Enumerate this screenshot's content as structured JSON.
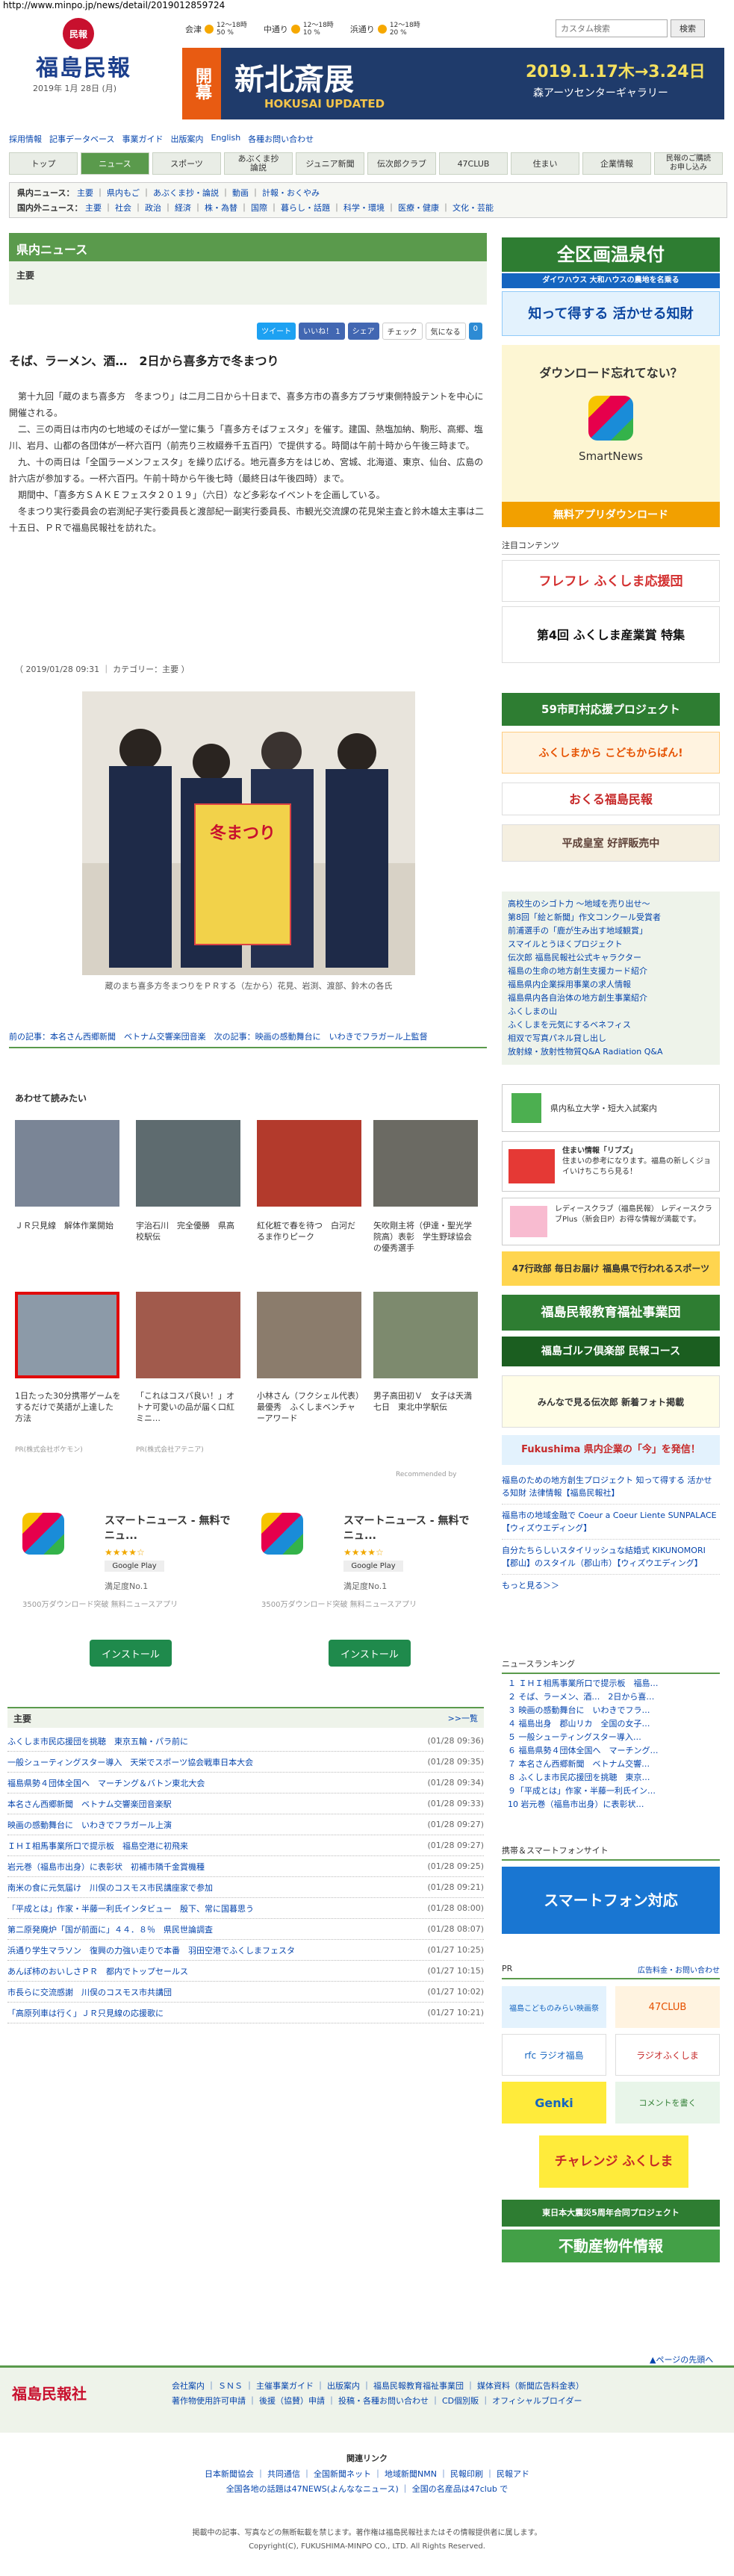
{
  "url": "http://www.minpo.jp/news/detail/2019012859724",
  "brand": {
    "logo_seal": "民報",
    "name": "福島民報",
    "date": "2019年 1月 28日 (月)",
    "green": "#5a9a4c"
  },
  "weather": [
    {
      "city": "会津",
      "temp": "12〜18時",
      "pct": "50 %"
    },
    {
      "city": "中通り",
      "temp": "12〜18時",
      "pct": "10 %"
    },
    {
      "city": "浜通り",
      "temp": "12〜18時",
      "pct": "20 %"
    }
  ],
  "search": {
    "placeholder": "カスタム検索",
    "button": "検索"
  },
  "ad_top": {
    "kanji": "開幕",
    "headline": "新北斎展",
    "sub": "HOKUSAI UPDATED",
    "dates": "2019.1.17木→3.24日",
    "venue": "森アーツセンターギャラリー"
  },
  "util_links": [
    "採用情報",
    "記事データベース",
    "事業ガイド",
    "出版案内",
    "English",
    "各種お問い合わせ"
  ],
  "tabs": [
    "トップ",
    "ニュース",
    "スポーツ",
    "あぶくま抄\n論説",
    "ジュニア新聞",
    "伝次郎クラブ",
    "47CLUB",
    "住まい",
    "企業情報",
    "民報のご購読\nお申し込み"
  ],
  "subnav1": {
    "label": "県内ニュース：",
    "items": [
      "主要",
      "県内もご",
      "あぶくま抄・論説",
      "動画",
      "計報・おくやみ"
    ]
  },
  "subnav2": {
    "label": "国内外ニュース：",
    "items": [
      "主要",
      "社会",
      "政治",
      "経済",
      "株・為替",
      "国際",
      "暮らし・話題",
      "科学・環境",
      "医療・健康",
      "文化・芸能"
    ]
  },
  "section_title": "県内ニュース",
  "section_sub": "主要",
  "share": {
    "tweet": "ツイート",
    "like": "いいね！ 1",
    "share": "シェア",
    "check": "チェック",
    "pocket": "気になる",
    "count": "0"
  },
  "article": {
    "title": "そば、ラーメン、酒…　2日から喜多方で冬まつり",
    "p1": "第十九回「蔵のまち喜多方　冬まつり」は二月二日から十日まで、喜多方市の喜多方プラザ東側特設テントを中心に開催される。",
    "p2": "二、三の両日は市内の七地域のそばが一堂に集う「喜多方そばフェスタ」を催す。建国、熱塩加納、駒形、高郷、塩川、岩月、山都の各団体が一杯六百円（前売り三枚綴券千五百円）で提供する。時間は午前十時から午後三時まで。",
    "p3": "九、十の両日は「全国ラーメンフェスタ」を繰り広げる。地元喜多方をはじめ、宮城、北海道、東京、仙台、広島の計六店が参加する。一杯六百円。午前十時から午後七時（最終日は午後四時）まで。",
    "p4": "期間中、「喜多方ＳＡＫＥフェスタ２０１９」（六日）など多彩なイベントを企画している。",
    "p5": "冬まつり実行委員会の岩渕紀子実行委員長と渡部紀一副実行委員長、市観光交流課の花見栄主査と鈴木雄太主事は二十五日、ＰＲで福島民報社を訪れた。",
    "meta": "（ 2019/01/28 09:31 ｜ カテゴリー：主要 ）",
    "photo_poster": "冬まつり",
    "caption": "蔵のまち喜多方冬まつりをＰＲする（左から）花見、岩渕、渡部、鈴木の各氏",
    "prev": "前の記事：本名さん西郷新聞　ベトナム交響楽団音楽",
    "next": "次の記事：映画の感動舞台に　いわきでフラガール上監督"
  },
  "related": {
    "title": "あわせて読みたい",
    "items": [
      "ＪＲ只見線　解体作業開始",
      "宇治石川　完全優勝　県高校駅伝",
      "紅化粧で春を待つ　白河だるま作りピーク",
      "矢吹剛主将（伊達・聖光学院高）表彰　学生野球協会の優秀選手",
      "1日たった30分携帯ゲームをするだけで英語が上達した方法",
      "「これはコスパ良い！」オトナ可愛いの品が届く口紅ミニ…",
      "小林さん（フクシェル代表）最優秀　ふくしまベンチャーアワード",
      "男子高田初Ｖ　女子は天満七日　東北中学駅伝"
    ],
    "promo1": "PR(株式会社ポケモン)",
    "promo2": "PR(株式会社アテニア)",
    "recommend": "Recommended by"
  },
  "apps": [
    {
      "name": "スマートニュース - 無料でニュ...",
      "stars": "★★★★☆",
      "store": "Google Play",
      "desc": "満足度No.1",
      "detail": "3500万ダウンロード突破 無料ニュースアプリ",
      "install": "インストール"
    },
    {
      "name": "スマートニュース - 無料でニュ...",
      "stars": "★★★★☆",
      "store": "Google Play",
      "desc": "満足度No.1",
      "detail": "3500万ダウンロード突破 無料ニュースアプリ",
      "install": "インストール"
    }
  ],
  "major_list": {
    "title": "主要",
    "more": ">>一覧",
    "rows": [
      [
        "ふくしま市民応援団を挑聴　東京五輪・パラ前に",
        "(01/28 09:36)"
      ],
      [
        "一般シューティングスター導入　天栄でスポーツ協会戦車日本大会",
        "(01/28 09:35)"
      ],
      [
        "福島県勢４団体全国へ　マーチング＆バトン東北大会",
        "(01/28 09:34)"
      ],
      [
        "本名さん西郷新聞　ベトナム交響楽団音楽駅",
        "(01/28 09:33)"
      ],
      [
        "映画の感動舞台に　いわきでフラガール上演",
        "(01/28 09:27)"
      ],
      [
        "ＩＨＩ相馬事業所口で提示板　福島空港に初飛来",
        "(01/28 09:27)"
      ],
      [
        "岩元巻（福島市出身）に表彰状　初補市隣千金賞機種",
        "(01/28 09:25)"
      ],
      [
        "南米の食に元気届け　川俣のコスモス市民講座家で参加",
        "(01/28 09:21)"
      ],
      [
        "「平成とは」作家・半藤一利氏インタビュー　殷下、常に国暮思う",
        "(01/28 08:00)"
      ],
      [
        "第二原発廃炉「国が前面に」４４．８％　県民世論調査",
        "(01/28 08:07)"
      ],
      [
        "浜通り学生マラソン　復興の力強い走りで本番　羽田空港でふくしまフェスタ",
        "(01/27 10:25)"
      ],
      [
        "あんぽ柿のおいしさＰＲ　都内でトップセールス",
        "(01/27 10:15)"
      ],
      [
        "市長らに交流感謝　川俣のコスモス市共講団",
        "(01/27 10:02)"
      ],
      [
        "「高原列車は行く」ＪＲ只見線の応援歌に",
        "(01/27 10:21)"
      ]
    ]
  },
  "right": {
    "onsen": "全区画温泉付",
    "daiwa": "ダイワハウス 大和ハウスの農地を名乗る",
    "shiru": "知って得する 活かせる知財",
    "smartnews_q": "ダウンロード忘れてない？",
    "smartnews_name": "SmartNews",
    "smartnews_btn": "無料アプリダウンロード",
    "attention_title": "注目コンテンツ",
    "furefure": "フレフレ ふくしま応援団",
    "sangyo": "第4回 ふくしま産業賞 特集",
    "city": "59市町村応援プロジェクト",
    "campaign": "ふくしまから こどもからばん!",
    "youtube": "おくる福島民報",
    "heisei": "平成皇室 好評販売中",
    "attention": [
      "高校生のシゴト力 〜地域を売り出せ〜",
      "第8回「絵と新聞」作文コンクール受賞者",
      "前浦選手の「鹿が生み出す地域観賞」",
      "スマイルとうほくプロジェクト",
      "伝次郎 福島民報社公式キャラクター",
      "福島の生命の地方創生支援カード紹介",
      "福島県内企業採用事業の求人情報",
      "福島県内各自治体の地方創生事業紹介",
      "ふくしまの山",
      "ふくしまを元気にするベネフィス",
      "相双で写真パネル貸し出し",
      "放射線・放射性物質Q&A Radiation Q&A"
    ],
    "univ": "県内私立大学・短大入試案内",
    "sumai_title": "住まい情報「リブズ」",
    "sumai_text": "住まいの参考になります。福島の新しくジョイいけちこちら見る！",
    "ladies": "レディースクラブ（福島民報） レディースクラブPlus（新会日P）お得な情報が満載です。",
    "sports": "47行政部 毎日お届け 福島県で行われるスポーツ",
    "ikueikai": "福島民報教育福祉事業団",
    "golf": "福島ゴルフ倶楽部 民報コース",
    "denjiro": "みんなで見る伝次郎 新着フォト掲載",
    "fukushima_box": "Fukushima 県内企業の「今」を発信！",
    "ads": [
      "福島のための地方創生プロジェクト 知って得する 活かせる知財 法律情報【福島民報社】",
      "福島市の地域金融で Coeur a Coeur Liente SUNPALACE【ウィズウエディング】",
      "自分たちらしいスタイリッシュな結婚式 KIKUNOMORI【郡山】のスタイル（郡山市）【ウィズウエディング】"
    ],
    "more_ads": "もっと見る＞＞",
    "ranking_title": "ニュースランキング",
    "ranking": [
      "１ ＩＨＩ相馬事業所口で提示板　福島…",
      "２ そば、ラーメン、酒…　2日から喜…",
      "３ 映画の感動舞台に　いわきでフラ…",
      "４ 福島出身　郡山リカ　全国の女子…",
      "５ 一般シューティングスター導入…",
      "６ 福島県勢４団体全国へ　マーチング…",
      "７ 本名さん西郷新聞　ベトナム交響…",
      "８ ふくしま市民応援団を挑聴　東京…",
      "９「平成とは」作家・半藤一利氏イン…",
      "10 岩元巻（福島市出身）に表彰状…"
    ],
    "mobile_title": "携帯＆スマートフォンサイト",
    "smartphone": "スマートフォン対応",
    "pr_title": "PR",
    "pr_link": "広告料金・お問い合わせ",
    "pr": [
      "福島こどものみらい映画祭",
      "47CLUB",
      "rfc ラジオ福島",
      "ラジオふくしま",
      "Genki",
      "コメントを書く",
      "チャレンジ ふくしま",
      "東日本大震災5周年合同プロジェクト",
      "不動産物件情報"
    ]
  },
  "footer": {
    "top": "▲ページの先頭へ",
    "logo": "福島民報社",
    "links1": "会社案内 ｜ ＳＮＳ ｜ 主催事業ガイド ｜ 出版案内 ｜ 福島民報教育福祉事業団 ｜ 媒体資料（新聞広告料金表）",
    "links2": "著作物使用許可申請 ｜ 後援（協賛）申請 ｜ 投稿・各種お問い合わせ ｜ CD個別販 ｜ オフィシャルブロイダー",
    "links_title": "関連リンク",
    "links3": "日本新聞協会 ｜ 共同通信 ｜ 全国新聞ネット ｜ 地域新聞NMN ｜ 民報印刷 ｜ 民報アド",
    "links4": "全国各地の話題は47NEWS(よんななニュース) ｜ 全国の名産品は47club で",
    "copy1": "掲載中の記事、写真などの無断転載を禁じます。著作権は福島民報社またはその情報提供者に属します。",
    "copy2": "Copyright(C), FUKUSHIMA-MINPO CO., LTD. All Rights Reserved."
  }
}
